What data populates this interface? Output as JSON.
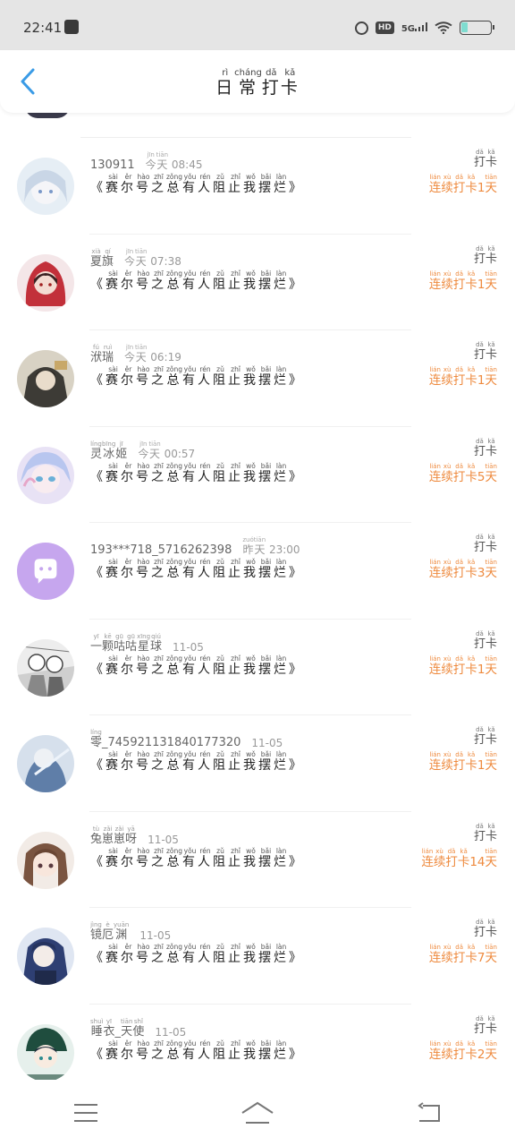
{
  "status_bar": {
    "time": "22:41",
    "network": "5G",
    "hd": "HD",
    "icons": [
      "app-notification-icon",
      "alarm-icon",
      "hd-icon",
      "signal-icon",
      "wifi-icon",
      "battery-icon"
    ]
  },
  "header": {
    "title_chars": [
      {
        "char": "日",
        "pinyin": "rì"
      },
      {
        "char": "常",
        "pinyin": "cháng"
      },
      {
        "char": "打",
        "pinyin": "dǎ"
      },
      {
        "char": "卡",
        "pinyin": "kǎ"
      }
    ]
  },
  "accent_color": "#ee8a3e",
  "right_label": [
    {
      "char": "打",
      "pinyin": "dǎ"
    },
    {
      "char": "卡",
      "pinyin": "kǎ"
    }
  ],
  "post_title_chars": [
    {
      "char": "《",
      "pinyin": ""
    },
    {
      "char": "赛",
      "pinyin": "sài"
    },
    {
      "char": "尔",
      "pinyin": "ěr"
    },
    {
      "char": "号",
      "pinyin": "hào"
    },
    {
      "char": "之",
      "pinyin": "zhī"
    },
    {
      "char": "总",
      "pinyin": "zǒng"
    },
    {
      "char": "有",
      "pinyin": "yǒu"
    },
    {
      "char": "人",
      "pinyin": "rén"
    },
    {
      "char": "阻",
      "pinyin": "zǔ"
    },
    {
      "char": "止",
      "pinyin": "zhǐ"
    },
    {
      "char": "我",
      "pinyin": "wǒ"
    },
    {
      "char": "摆",
      "pinyin": "bǎi"
    },
    {
      "char": "烂",
      "pinyin": "làn"
    },
    {
      "char": "》",
      "pinyin": ""
    }
  ],
  "entries": [
    {
      "name_chars": [
        {
          "char": "130911",
          "pinyin": ""
        }
      ],
      "time_chars": [
        {
          "char": "今",
          "pinyin": "jīn"
        },
        {
          "char": "天",
          "pinyin": "tiān"
        },
        {
          "char": " 08:45",
          "pinyin": ""
        }
      ],
      "streak_days": "1",
      "avatar": "avatar-white-hair"
    },
    {
      "name_chars": [
        {
          "char": "夏",
          "pinyin": "xià"
        },
        {
          "char": "旗",
          "pinyin": "qí"
        }
      ],
      "time_chars": [
        {
          "char": "今",
          "pinyin": "jīn"
        },
        {
          "char": "天",
          "pinyin": "tiān"
        },
        {
          "char": " 07:38",
          "pinyin": ""
        }
      ],
      "streak_days": "1",
      "avatar": "avatar-red-hood"
    },
    {
      "name_chars": [
        {
          "char": "洑",
          "pinyin": "fú"
        },
        {
          "char": "瑞",
          "pinyin": "ruì"
        }
      ],
      "time_chars": [
        {
          "char": "今",
          "pinyin": "jīn"
        },
        {
          "char": "天",
          "pinyin": "tiān"
        },
        {
          "char": " 06:19",
          "pinyin": ""
        }
      ],
      "streak_days": "1",
      "avatar": "avatar-dark-character"
    },
    {
      "name_chars": [
        {
          "char": "灵",
          "pinyin": "líng"
        },
        {
          "char": "冰",
          "pinyin": "bīng"
        },
        {
          "char": "姬",
          "pinyin": "jī"
        }
      ],
      "time_chars": [
        {
          "char": "今",
          "pinyin": "jīn"
        },
        {
          "char": "天",
          "pinyin": "tiān"
        },
        {
          "char": " 00:57",
          "pinyin": ""
        }
      ],
      "streak_days": "5",
      "avatar": "avatar-pastel-girl"
    },
    {
      "name_chars": [
        {
          "char": "193***718_5716262398",
          "pinyin": ""
        }
      ],
      "time_chars": [
        {
          "char": "昨",
          "pinyin": "zuó"
        },
        {
          "char": "天",
          "pinyin": "tiān"
        },
        {
          "char": " 23:00",
          "pinyin": ""
        }
      ],
      "streak_days": "3",
      "avatar": "avatar-default-chat"
    },
    {
      "name_chars": [
        {
          "char": "一",
          "pinyin": "yī"
        },
        {
          "char": "颗",
          "pinyin": "kē"
        },
        {
          "char": "咕",
          "pinyin": "gū"
        },
        {
          "char": "咕",
          "pinyin": "gū"
        },
        {
          "char": "星",
          "pinyin": "xīng"
        },
        {
          "char": "球",
          "pinyin": "qiú"
        }
      ],
      "time_chars": [
        {
          "char": "11-05",
          "pinyin": ""
        }
      ],
      "streak_days": "1",
      "avatar": "avatar-manga-sketch"
    },
    {
      "name_chars": [
        {
          "char": "零",
          "pinyin": "líng"
        },
        {
          "char": "_745921131840177320",
          "pinyin": ""
        }
      ],
      "time_chars": [
        {
          "char": "11-05",
          "pinyin": ""
        }
      ],
      "streak_days": "1",
      "avatar": "avatar-blue-warrior"
    },
    {
      "name_chars": [
        {
          "char": "兔",
          "pinyin": "tù"
        },
        {
          "char": "崽",
          "pinyin": "zǎi"
        },
        {
          "char": "崽",
          "pinyin": "zǎi"
        },
        {
          "char": "呀",
          "pinyin": "yā"
        }
      ],
      "time_chars": [
        {
          "char": "11-05",
          "pinyin": ""
        }
      ],
      "streak_days": "14",
      "avatar": "avatar-brown-hair-girl"
    },
    {
      "name_chars": [
        {
          "char": "镜",
          "pinyin": "jìng"
        },
        {
          "char": "厄",
          "pinyin": "è"
        },
        {
          "char": "渊",
          "pinyin": "yuān"
        }
      ],
      "time_chars": [
        {
          "char": "11-05",
          "pinyin": ""
        }
      ],
      "streak_days": "7",
      "avatar": "avatar-blue-hair-woman"
    },
    {
      "name_chars": [
        {
          "char": "睡",
          "pinyin": "shuì"
        },
        {
          "char": "衣",
          "pinyin": "yī"
        },
        {
          "char": "_",
          "pinyin": ""
        },
        {
          "char": "天",
          "pinyin": "tiān"
        },
        {
          "char": "使",
          "pinyin": "shǐ"
        }
      ],
      "time_chars": [
        {
          "char": "11-05",
          "pinyin": ""
        }
      ],
      "streak_days": "2",
      "avatar": "avatar-green-hat-boy"
    }
  ],
  "streak_prefix": [
    {
      "char": "连",
      "pinyin": "lián"
    },
    {
      "char": "续",
      "pinyin": "xù"
    },
    {
      "char": "打",
      "pinyin": "dǎ"
    },
    {
      "char": "卡",
      "pinyin": "kǎ"
    }
  ],
  "streak_suffix": {
    "char": "天",
    "pinyin": "tiān"
  },
  "nav_bar": {
    "icons": [
      "menu-icon",
      "home-icon",
      "back-icon"
    ]
  }
}
